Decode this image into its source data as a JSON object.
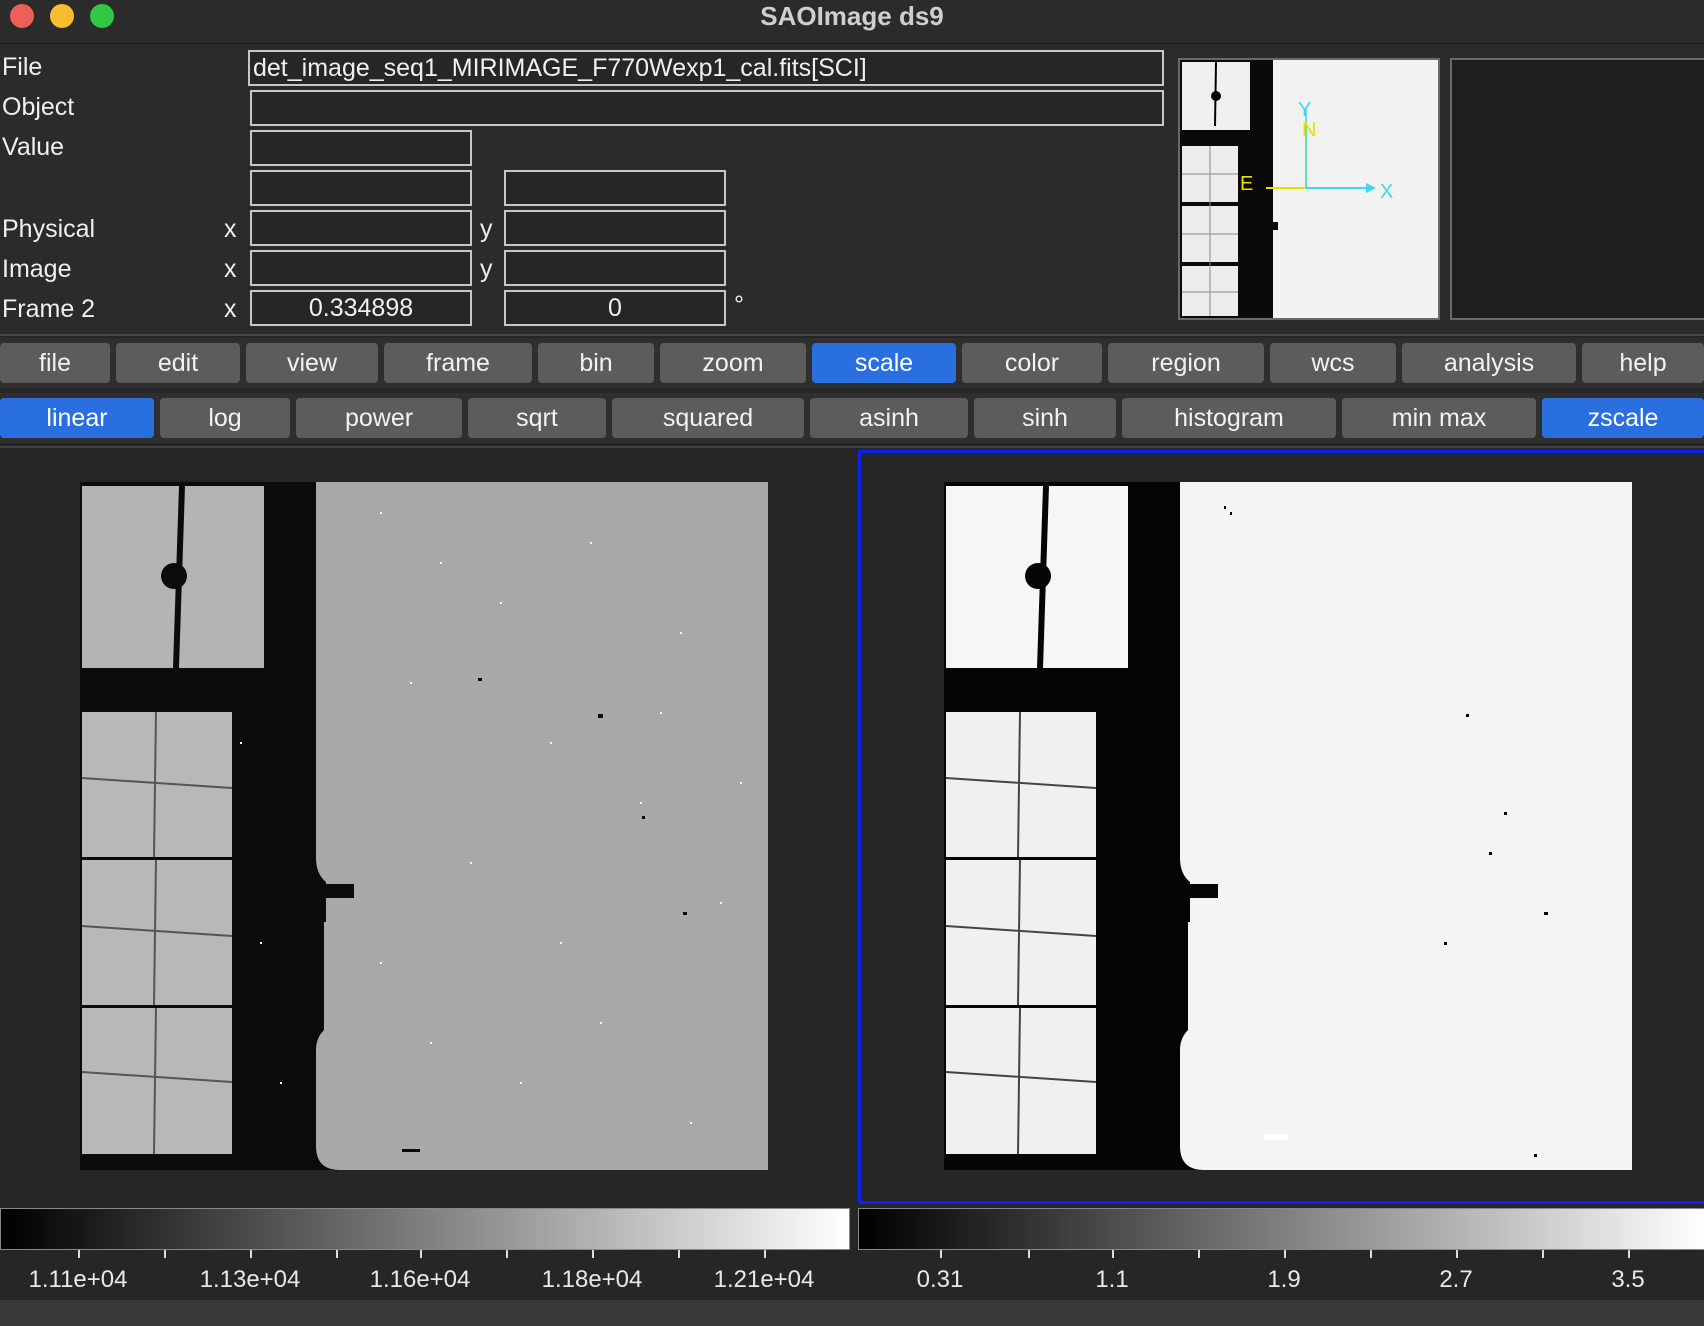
{
  "window": {
    "title": "SAOImage ds9"
  },
  "info": {
    "file_label": "File",
    "file_value": "det_image_seq1_MIRIMAGE_F770Wexp1_cal.fits[SCI]",
    "object_label": "Object",
    "object_value": "",
    "value_label": "Value",
    "value_value": "",
    "physical_label": "Physical",
    "image_label": "Image",
    "frame_label": "Frame 2",
    "x_label": "x",
    "y_label": "y",
    "frame_x_value": "0.334898",
    "frame_y_value": "0",
    "degree_symbol": "°"
  },
  "panner": {
    "compass_n": "N",
    "compass_e": "E",
    "axis_x": "X",
    "axis_y": "Y"
  },
  "menu": [
    "file",
    "edit",
    "view",
    "frame",
    "bin",
    "zoom",
    "scale",
    "color",
    "region",
    "wcs",
    "analysis",
    "help"
  ],
  "menu_active": "scale",
  "scale_buttons": [
    "linear",
    "log",
    "power",
    "sqrt",
    "squared",
    "asinh",
    "sinh",
    "histogram",
    "min max",
    "zscale"
  ],
  "scale_active": [
    "linear",
    "zscale"
  ],
  "colorbar_left": {
    "ticks": [
      "1.11e+04",
      "1.13e+04",
      "1.16e+04",
      "1.18e+04",
      "1.21e+04"
    ]
  },
  "colorbar_right": {
    "ticks": [
      "0.31",
      "1.1",
      "1.9",
      "2.7",
      "3.5"
    ]
  },
  "colors": {
    "accent": "#2a6fe0",
    "frame_highlight": "#0a1ff0",
    "compass_yellow": "#e8e000",
    "compass_cyan": "#3fd8f0"
  }
}
